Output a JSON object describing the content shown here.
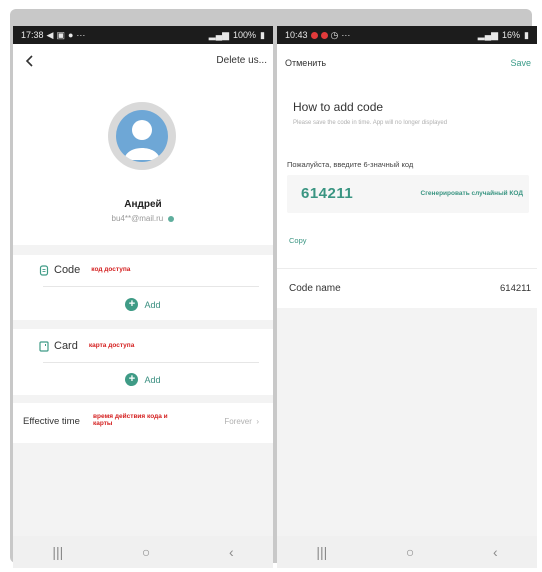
{
  "left_screen": {
    "status_bar": {
      "time": "17:38",
      "battery": "100%"
    },
    "delete_label": "Delete us...",
    "user": {
      "name": "Андрей",
      "email": "bu4**@mail.ru"
    },
    "code_section": {
      "title": "Code",
      "note": "код доступа",
      "add_label": "Add"
    },
    "card_section": {
      "title": "Card",
      "note": "карта доступа",
      "add_label": "Add"
    },
    "effective_time": {
      "label": "Effective time",
      "note": "время действия кода и карты",
      "value": "Forever"
    }
  },
  "right_screen": {
    "status_bar": {
      "time": "10:43",
      "battery": "16%"
    },
    "cancel_label": "Отменить",
    "save_label": "Save",
    "title": "How to add code",
    "subtitle": "Please save the code in time. App will no longer displayed",
    "enter_label": "Пожалуйста, введите 6-значный код",
    "code_value": "614211",
    "generate_label": "Сгенерировать случайный КОД",
    "copy_label": "Copy",
    "code_name": {
      "label": "Code name",
      "value": "614211"
    }
  },
  "colors": {
    "accent": "#3a9582",
    "annotation_red": "#d42020",
    "avatar_blue": "#6ea7d6"
  }
}
